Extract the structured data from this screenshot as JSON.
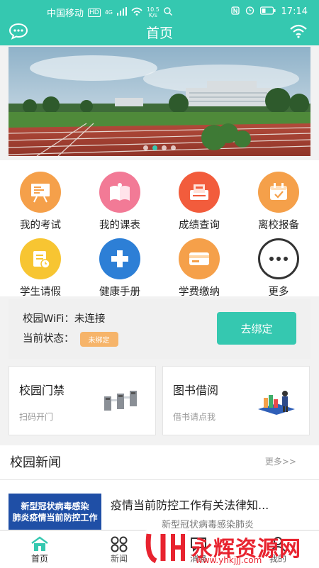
{
  "status_bar": {
    "carrier": "中国移动",
    "hd": "HD",
    "net": "4G",
    "speed_value": "10.5",
    "speed_unit": "K/s",
    "time": "17:14"
  },
  "header": {
    "title": "首页"
  },
  "banner": {
    "dot_count": 4,
    "active_dot": 1
  },
  "grid": {
    "items": [
      {
        "label": "我的考试",
        "icon": "exam-icon",
        "color": "#f5a04a"
      },
      {
        "label": "我的课表",
        "icon": "schedule-icon",
        "color": "#f27a96"
      },
      {
        "label": "成绩查询",
        "icon": "grades-icon",
        "color": "#f25c3c"
      },
      {
        "label": "离校报备",
        "icon": "calendar-icon",
        "color": "#f5a04a"
      },
      {
        "label": "学生请假",
        "icon": "leave-icon",
        "color": "#f7c532"
      },
      {
        "label": "健康手册",
        "icon": "health-icon",
        "color": "#2d7fd6"
      },
      {
        "label": "学费缴纳",
        "icon": "payment-icon",
        "color": "#f5a04a"
      },
      {
        "label": "更多",
        "icon": "more-icon",
        "color": "#333333"
      }
    ]
  },
  "wifi": {
    "wifi_label": "校园WiFi：",
    "wifi_value": "未连接",
    "status_label": "当前状态：",
    "status_badge": "未绑定",
    "bind_button": "去绑定"
  },
  "cards": {
    "access": {
      "title": "校园门禁",
      "subtitle": "扫码开门"
    },
    "library": {
      "title": "图书借阅",
      "subtitle": "借书请点我"
    }
  },
  "news": {
    "title": "校园新闻",
    "more": "更多>>",
    "items": [
      {
        "thumb_line1": "新型冠状病毒感染",
        "thumb_line2": "肺炎疫情当前防控工作",
        "title": "疫情当前防控工作有关法律知...",
        "subtitle": "新型冠状病毒感染肺炎"
      }
    ]
  },
  "tabbar": {
    "tabs": [
      {
        "label": "首页"
      },
      {
        "label": "新闻"
      },
      {
        "label": "消息"
      },
      {
        "label": "我的"
      }
    ]
  },
  "watermark": {
    "text": "永辉资源网",
    "url": "www.yhkjjj.com"
  },
  "colors": {
    "accent": "#35c8b0",
    "badge": "#f6b46a",
    "watermark": "#e8232f"
  }
}
